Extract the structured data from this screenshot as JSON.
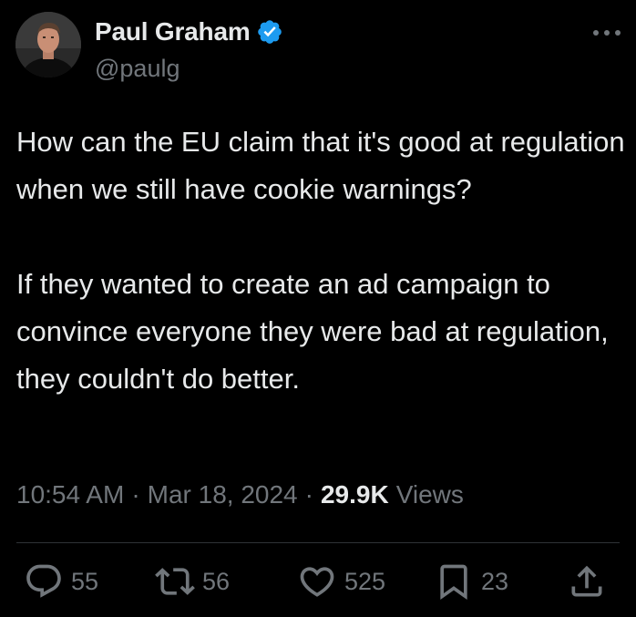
{
  "author": {
    "display_name": "Paul Graham",
    "handle": "@paulg",
    "verified": true,
    "verified_color": "#1d9bf0"
  },
  "tweet": {
    "paragraphs": [
      "How can the EU claim that it's good at regulation when we still have cookie warnings?",
      "If they wanted to create an ad campaign to convince everyone they were bad at regulation, they couldn't do better."
    ],
    "time": "10:54 AM",
    "separator": "·",
    "date": "Mar 18, 2024",
    "views_count": "29.9K",
    "views_label": "Views"
  },
  "actions": {
    "replies": "55",
    "reposts": "56",
    "likes": "525",
    "bookmarks": "23"
  },
  "icons": {
    "more": "more-horizontal-icon",
    "reply": "reply-icon",
    "repost": "repost-icon",
    "like": "heart-icon",
    "bookmark": "bookmark-icon",
    "share": "share-icon",
    "verified": "verified-badge-icon"
  },
  "colors": {
    "background": "#000000",
    "text": "#e7e9ea",
    "secondary": "#71767b",
    "divider": "#2f3336"
  }
}
